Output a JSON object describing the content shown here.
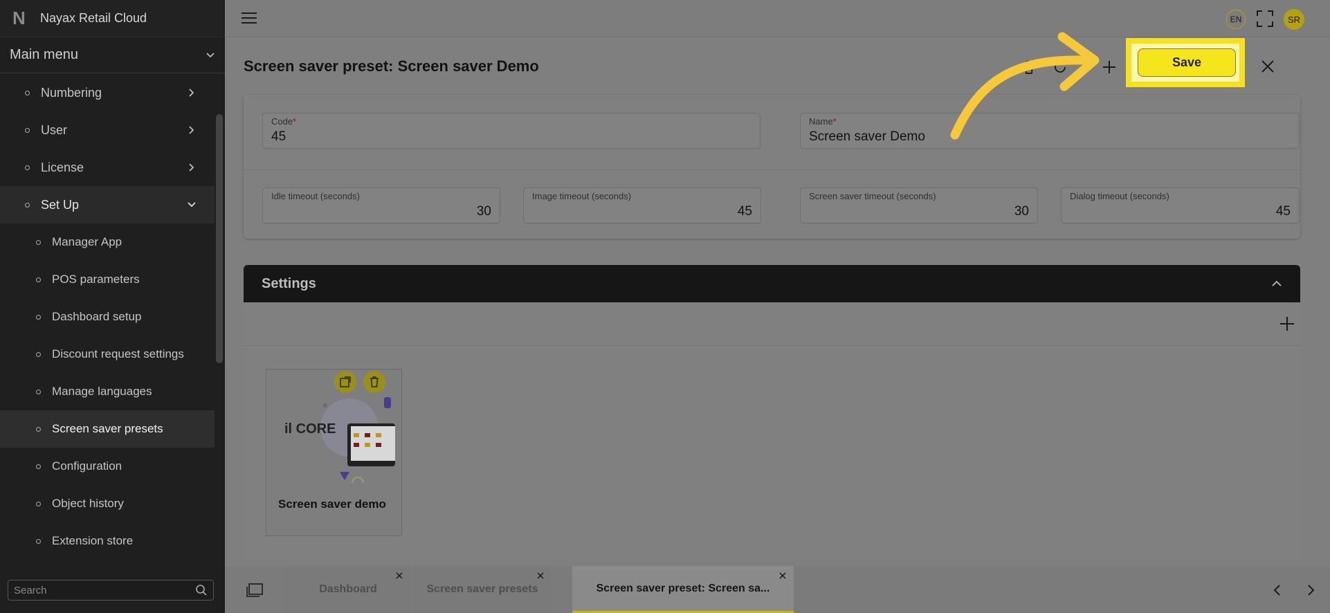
{
  "app": {
    "logo_glyph": "N",
    "title": "Nayax Retail Cloud"
  },
  "sidebar": {
    "main_menu_label": "Main menu",
    "items": [
      {
        "label": "Numbering",
        "level": 1,
        "chevron": "right"
      },
      {
        "label": "User",
        "level": 1,
        "chevron": "right"
      },
      {
        "label": "License",
        "level": 1,
        "chevron": "right"
      },
      {
        "label": "Set Up",
        "level": 1,
        "chevron": "down",
        "expanded": true
      },
      {
        "label": "Manager App",
        "level": 2
      },
      {
        "label": "POS parameters",
        "level": 2
      },
      {
        "label": "Dashboard setup",
        "level": 2
      },
      {
        "label": "Discount request settings",
        "level": 2
      },
      {
        "label": "Manage languages",
        "level": 2
      },
      {
        "label": "Screen saver presets",
        "level": 2,
        "active": true
      },
      {
        "label": "Configuration",
        "level": 2
      },
      {
        "label": "Object history",
        "level": 2
      },
      {
        "label": "Extension store",
        "level": 2
      }
    ],
    "search_placeholder": "Search"
  },
  "topbar": {
    "language": "EN",
    "avatar_initials": "SR"
  },
  "page": {
    "title": "Screen saver preset: Screen saver Demo",
    "save_label": "Save"
  },
  "form": {
    "code": {
      "label": "Code",
      "required_mark": "*",
      "value": "45"
    },
    "name": {
      "label": "Name",
      "required_mark": "*",
      "value": "Screen saver Demo"
    },
    "idle_timeout": {
      "label": "Idle timeout (seconds)",
      "value": "30"
    },
    "image_timeout": {
      "label": "Image timeout (seconds)",
      "value": "45"
    },
    "screen_saver_timeout": {
      "label": "Screen saver timeout (seconds)",
      "value": "30"
    },
    "dialog_timeout": {
      "label": "Dialog timeout (seconds)",
      "value": "45"
    }
  },
  "settings": {
    "title": "Settings",
    "preset_card": {
      "name": "Screen saver demo",
      "logo_text": "il CORE"
    }
  },
  "tabs": [
    {
      "label": "Dashboard",
      "active": false
    },
    {
      "label": "Screen saver presets",
      "active": false
    },
    {
      "label": "Screen saver preset: Screen sa...",
      "active": true
    }
  ],
  "colors": {
    "accent_yellow": "#f5e51c",
    "highlight_yellow": "#f7e11e",
    "sidebar_bg": "#1f1f1f",
    "settings_header_bg": "#161616"
  }
}
